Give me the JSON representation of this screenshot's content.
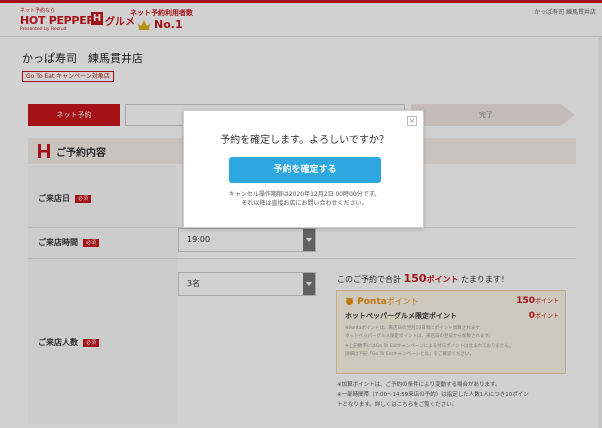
{
  "header": {
    "logo_small": "ネット予約なら",
    "logo_main": "HOT PEPPER",
    "logo_h": "H",
    "logo_gurume": "グルメ",
    "logo_sub": "Presented by Recruit",
    "no1_line1": "ネット予約利用者数",
    "no1_line2": "No.1",
    "shop_link": "かっぱ寿司 練馬貫井店"
  },
  "shop": {
    "name": "かっぱ寿司　練馬貫井店",
    "goto_tag": "Go To Eat キャンペーン対象店"
  },
  "steps": {
    "step1": "ネット予約",
    "step2": "",
    "step3": "完了"
  },
  "section": {
    "title": "ご予約内容"
  },
  "form": {
    "required": "必須",
    "date_label": "ご来店日",
    "time_label": "ご来店時間",
    "time_value": "19:00",
    "people_label": "ご来店人数",
    "people_value": "3名"
  },
  "points": {
    "message_prefix": "このご予約で合計",
    "message_points": "150",
    "message_suffix": "ポイント",
    "message_end": "たまります！",
    "ponta_name": "Ponta",
    "ponta_pt": "ポイント",
    "ponta_value": "150",
    "ponta_unit": "ポイント",
    "hp_label": "ホットペッパーグルメ限定ポイント",
    "hp_value": "0",
    "hp_unit": "ポイント",
    "note1": "※Pontaポイントは、来店日の翌月10日頃にポイント加算されます。",
    "note2": "ホットペッパーグルメ限定ポイントは、来店日の翌日から加算されます。",
    "note3": "※上記数字にはGo To Eatキャンペーンによる付与ポイントは含まれておりません。",
    "note4": "詳細は下記「Go To Eatキャンペーンとは」をご確認ください。"
  },
  "footer_notes": {
    "line1": "※加算ポイントは、ご予約の条件により変動する場合があります。",
    "line2": "※一部時間帯（7:00〜14:59来店の予約）は指定した人数1人につき10ポイン",
    "line3": "トとなります。詳しくはこちらをご覧ください。"
  },
  "modal": {
    "close": "×",
    "question": "予約を確定します。よろしいですか？",
    "confirm_button": "予約を確定する",
    "note_line1": "キャンセル操作期限は2020年12月2日 00時00分です。",
    "note_line2": "それ以降は直接お店にお問い合わせください。"
  },
  "colors": {
    "brand_red": "#c8161d",
    "button_blue": "#2ea7e0",
    "ponta_orange": "#e9910f"
  }
}
